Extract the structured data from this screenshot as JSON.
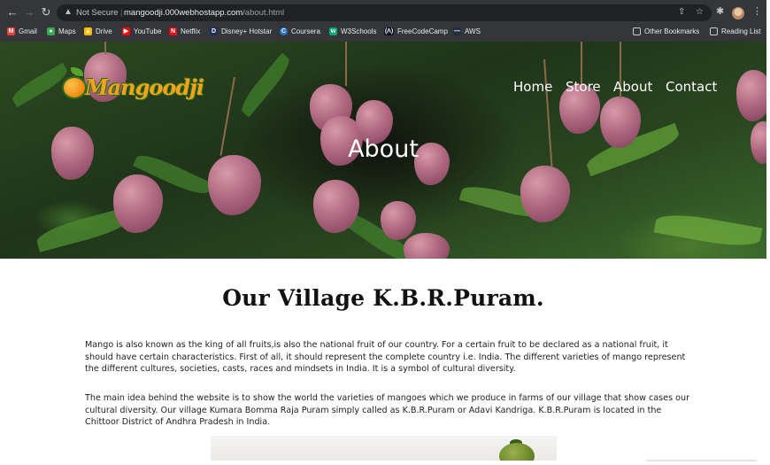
{
  "browser": {
    "security_label": "Not Secure",
    "url_host": "mangoodji.000webhostapp.com",
    "url_path": "/about.html"
  },
  "bookmarks": [
    {
      "label": "Gmail",
      "icon": "gmail-icon",
      "color": "#ea4335"
    },
    {
      "label": "Maps",
      "icon": "maps-icon",
      "color": "#34a853"
    },
    {
      "label": "Drive",
      "icon": "drive-icon",
      "color": "#fbbc04"
    },
    {
      "label": "YouTube",
      "icon": "youtube-icon",
      "color": "#ff0000"
    },
    {
      "label": "Netflix",
      "icon": "netflix-icon",
      "color": "#e50914"
    },
    {
      "label": "Disney+ Hotstar",
      "icon": "hotstar-icon",
      "color": "#1f2d5a"
    },
    {
      "label": "Coursera",
      "icon": "coursera-icon",
      "color": "#2a73cc"
    },
    {
      "label": "W3Schools",
      "icon": "w3schools-icon",
      "color": "#04aa6d"
    },
    {
      "label": "FreeCodeCamp",
      "icon": "freecodecamp-icon",
      "color": "#0a0a23"
    },
    {
      "label": "AWS",
      "icon": "aws-icon",
      "color": "#232f3e"
    }
  ],
  "other_bookmarks": "Other Bookmarks",
  "reading_list": "Reading List",
  "site": {
    "logo_text": "Mangoodji",
    "nav": [
      "Home",
      "Store",
      "About",
      "Contact"
    ],
    "hero_title": "About",
    "heading": "Our Village K.B.R.Puram.",
    "paragraph1": "Mango is also known as the king of all fruits,is also the national fruit of our country. For a certain fruit to be declared as a national fruit, it should have certain characteristics. First of all, it should represent the complete country i.e. India. The different varieties of mango represent the different cultures, societies, casts, races and mindsets in India. It is a symbol of cultural diversity.",
    "paragraph2": "The main idea behind the website is to show the world the varieties of mangoes which we produce in farms of our village that show cases our cultural diversity. Our village Kumara Bomma Raja Puram simply called as K.B.R.Puram or Adavi Kandriga. K.B.R.Puram is located in the Chittoor District of Andhra Pradesh in India."
  }
}
